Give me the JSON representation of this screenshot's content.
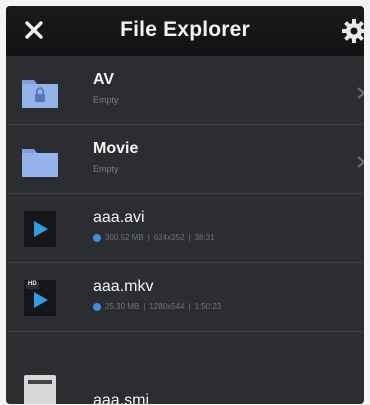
{
  "header": {
    "title": "File Explorer",
    "close_icon": "close-icon",
    "settings_icon": "gear-icon"
  },
  "items": [
    {
      "name": "AV",
      "subtitle": "Empty",
      "type": "folder-locked"
    },
    {
      "name": "Movie",
      "subtitle": "Empty",
      "type": "folder"
    },
    {
      "name": "aaa.avi",
      "size": "300.52 MB",
      "resolution": "624x352",
      "duration": "38:31",
      "type": "video"
    },
    {
      "name": "aaa.mkv",
      "size": "25.30 MB",
      "resolution": "1280x544",
      "duration": "1:50:23",
      "type": "video-hd",
      "badge": "HD"
    },
    {
      "name": "aaa.smi",
      "type": "subtitle"
    }
  ],
  "colors": {
    "background": "#2c2d30",
    "header": "#121315",
    "accent": "#3a8ee6",
    "folder": "#8fb0e8"
  }
}
